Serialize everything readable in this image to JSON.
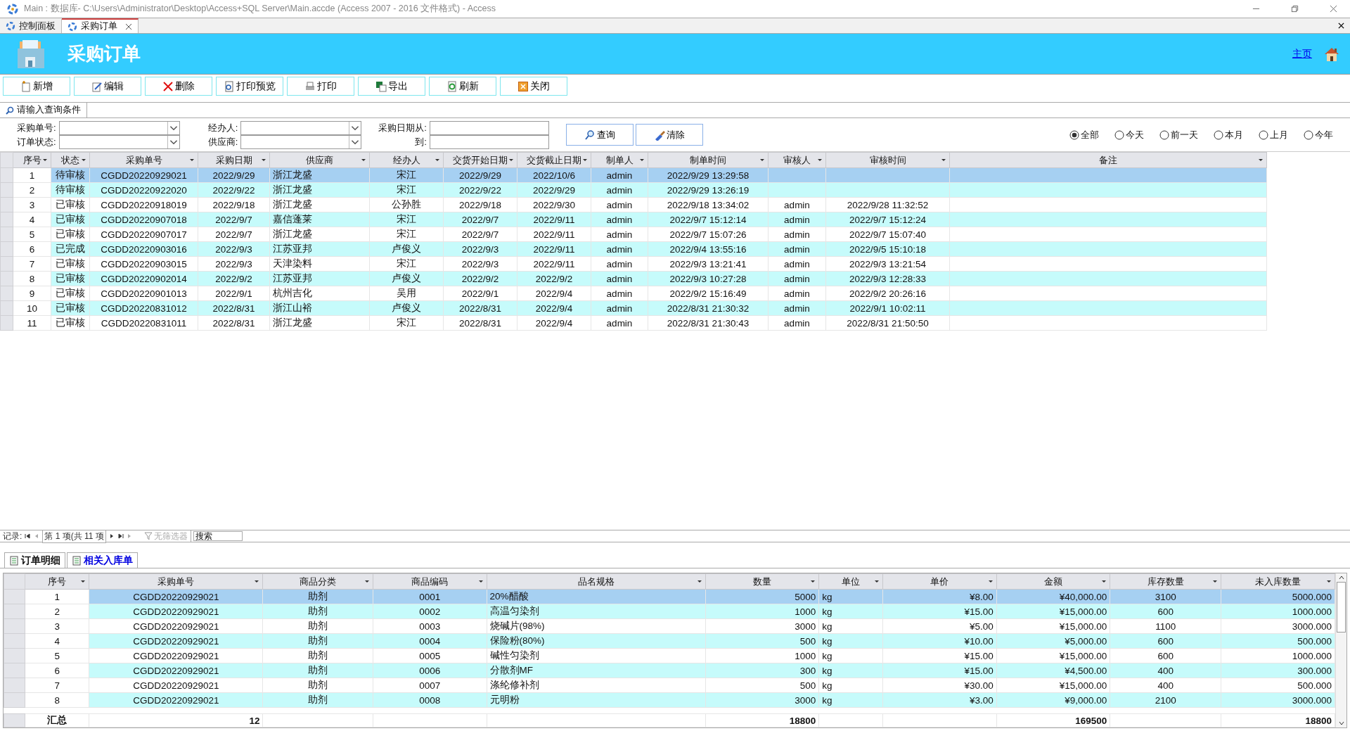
{
  "window": {
    "title": "Main : 数据库- C:\\Users\\Administrator\\Desktop\\Access+SQL Server\\Main.accde (Access 2007 - 2016 文件格式) - Access"
  },
  "doc_tabs": [
    {
      "label": "控制面板",
      "selected": false
    },
    {
      "label": "采购订单",
      "selected": true
    }
  ],
  "header": {
    "title": "采购订单",
    "home_link": "主页"
  },
  "toolbar": [
    {
      "kind": "new",
      "label": "新增"
    },
    {
      "kind": "edit",
      "label": "编辑"
    },
    {
      "kind": "delete",
      "label": "删除"
    },
    {
      "kind": "preview",
      "label": "打印预览"
    },
    {
      "kind": "print",
      "label": "打印"
    },
    {
      "kind": "export",
      "label": "导出"
    },
    {
      "kind": "refresh",
      "label": "刷新"
    },
    {
      "kind": "close",
      "label": "关闭"
    }
  ],
  "query": {
    "caption": "请输入查询条件",
    "fields": [
      {
        "label": "采购单号:",
        "kind": "combo"
      },
      {
        "label": "订单状态:",
        "kind": "combo"
      },
      {
        "label": "经办人:",
        "kind": "combo"
      },
      {
        "label": "供应商:",
        "kind": "combo"
      },
      {
        "label": "采购日期从:",
        "kind": "text"
      },
      {
        "label": "到:",
        "kind": "text"
      }
    ],
    "buttons": [
      {
        "kind": "search",
        "label": "查询"
      },
      {
        "kind": "clear",
        "label": "清除"
      }
    ],
    "ranges": [
      {
        "label": "全部",
        "selected": true
      },
      {
        "label": "今天",
        "selected": false
      },
      {
        "label": "前一天",
        "selected": false
      },
      {
        "label": "本月",
        "selected": false
      },
      {
        "label": "上月",
        "selected": false
      },
      {
        "label": "今年",
        "selected": false
      }
    ]
  },
  "orders": {
    "columns": [
      {
        "label": "序号",
        "kind": "center"
      },
      {
        "label": "状态",
        "kind": "center"
      },
      {
        "label": "采购单号",
        "kind": "center"
      },
      {
        "label": "采购日期",
        "kind": "center"
      },
      {
        "label": "供应商",
        "kind": "text"
      },
      {
        "label": "经办人",
        "kind": "center"
      },
      {
        "label": "交货开始日期",
        "kind": "center"
      },
      {
        "label": "交货截止日期",
        "kind": "center"
      },
      {
        "label": "制单人",
        "kind": "center"
      },
      {
        "label": "制单时间",
        "kind": "center"
      },
      {
        "label": "审核人",
        "kind": "center"
      },
      {
        "label": "审核时间",
        "kind": "center"
      },
      {
        "label": "备注",
        "kind": "text"
      }
    ],
    "rows": [
      {
        "selected": true,
        "cells": [
          "1",
          "待审核",
          "CGDD20220929021",
          "2022/9/29",
          "浙江龙盛",
          "宋江",
          "2022/9/29",
          "2022/10/6",
          "admin",
          "2022/9/29 13:29:58"
        ]
      },
      {
        "selected": false,
        "cells": [
          "2",
          "待审核",
          "CGDD20220922020",
          "2022/9/22",
          "浙江龙盛",
          "宋江",
          "2022/9/22",
          "2022/9/29",
          "admin",
          "2022/9/29 13:26:19"
        ]
      },
      {
        "selected": false,
        "cells": [
          "3",
          "已审核",
          "CGDD20220918019",
          "2022/9/18",
          "浙江龙盛",
          "公孙胜",
          "2022/9/18",
          "2022/9/30",
          "admin",
          "2022/9/18 13:34:02",
          "admin",
          "2022/9/28 11:32:52"
        ]
      },
      {
        "selected": false,
        "cells": [
          "4",
          "已审核",
          "CGDD20220907018",
          "2022/9/7",
          "嘉信蓬莱",
          "宋江",
          "2022/9/7",
          "2022/9/11",
          "admin",
          "2022/9/7 15:12:14",
          "admin",
          "2022/9/7 15:12:24"
        ]
      },
      {
        "selected": false,
        "cells": [
          "5",
          "已审核",
          "CGDD20220907017",
          "2022/9/7",
          "浙江龙盛",
          "宋江",
          "2022/9/7",
          "2022/9/11",
          "admin",
          "2022/9/7 15:07:26",
          "admin",
          "2022/9/7 15:07:40"
        ]
      },
      {
        "selected": false,
        "cells": [
          "6",
          "已完成",
          "CGDD20220903016",
          "2022/9/3",
          "江苏亚邦",
          "卢俊义",
          "2022/9/3",
          "2022/9/11",
          "admin",
          "2022/9/4 13:55:16",
          "admin",
          "2022/9/5 15:10:18"
        ]
      },
      {
        "selected": false,
        "cells": [
          "7",
          "已审核",
          "CGDD20220903015",
          "2022/9/3",
          "天津染料",
          "宋江",
          "2022/9/3",
          "2022/9/11",
          "admin",
          "2022/9/3 13:21:41",
          "admin",
          "2022/9/3 13:21:54"
        ]
      },
      {
        "selected": false,
        "cells": [
          "8",
          "已审核",
          "CGDD20220902014",
          "2022/9/2",
          "江苏亚邦",
          "卢俊义",
          "2022/9/2",
          "2022/9/2",
          "admin",
          "2022/9/3 10:27:28",
          "admin",
          "2022/9/3 12:28:33"
        ]
      },
      {
        "selected": false,
        "cells": [
          "9",
          "已审核",
          "CGDD20220901013",
          "2022/9/1",
          "杭州吉化",
          "吴用",
          "2022/9/1",
          "2022/9/4",
          "admin",
          "2022/9/2 15:16:49",
          "admin",
          "2022/9/2 20:26:16"
        ]
      },
      {
        "selected": false,
        "cells": [
          "10",
          "已审核",
          "CGDD20220831012",
          "2022/8/31",
          "浙江山裕",
          "卢俊义",
          "2022/8/31",
          "2022/9/4",
          "admin",
          "2022/8/31 21:30:32",
          "admin",
          "2022/9/1 10:02:11"
        ]
      },
      {
        "selected": false,
        "cells": [
          "11",
          "已审核",
          "CGDD20220831011",
          "2022/8/31",
          "浙江龙盛",
          "宋江",
          "2022/8/31",
          "2022/9/4",
          "admin",
          "2022/8/31 21:30:43",
          "admin",
          "2022/8/31 21:50:50"
        ]
      }
    ]
  },
  "navigator": {
    "label": "记录:",
    "position": "第 1 项(共 11 项",
    "filter": "无筛选器",
    "search_placeholder": "搜索"
  },
  "sub_tabs": [
    {
      "label": "订单明细",
      "selected": true
    },
    {
      "label": "相关入库单",
      "selected": false
    }
  ],
  "details": {
    "columns": [
      {
        "label": "序号",
        "kind": "center"
      },
      {
        "label": "采购单号",
        "kind": "center",
        "total": "12"
      },
      {
        "label": "商品分类",
        "kind": "center"
      },
      {
        "label": "商品编码",
        "kind": "center"
      },
      {
        "label": "品名规格",
        "kind": "text"
      },
      {
        "label": "数量",
        "kind": "num",
        "total": "18800"
      },
      {
        "label": "单位",
        "kind": "text"
      },
      {
        "label": "单价",
        "kind": "num"
      },
      {
        "label": "金额",
        "kind": "num",
        "total": "169500"
      },
      {
        "label": "库存数量",
        "kind": "center"
      },
      {
        "label": "未入库数量",
        "kind": "num",
        "total": "18800"
      }
    ],
    "rows": [
      {
        "selected": true,
        "cells": [
          "1",
          "CGDD20220929021",
          "助剂",
          "0001",
          "20%醋酸",
          "5000",
          "kg",
          "¥8.00",
          "¥40,000.00",
          "3100",
          "5000.000"
        ]
      },
      {
        "selected": false,
        "cells": [
          "2",
          "CGDD20220929021",
          "助剂",
          "0002",
          "高温匀染剂",
          "1000",
          "kg",
          "¥15.00",
          "¥15,000.00",
          "600",
          "1000.000"
        ]
      },
      {
        "selected": false,
        "cells": [
          "3",
          "CGDD20220929021",
          "助剂",
          "0003",
          "烧碱片(98%)",
          "3000",
          "kg",
          "¥5.00",
          "¥15,000.00",
          "1100",
          "3000.000"
        ]
      },
      {
        "selected": false,
        "cells": [
          "4",
          "CGDD20220929021",
          "助剂",
          "0004",
          "保险粉(80%)",
          "500",
          "kg",
          "¥10.00",
          "¥5,000.00",
          "600",
          "500.000"
        ]
      },
      {
        "selected": false,
        "cells": [
          "5",
          "CGDD20220929021",
          "助剂",
          "0005",
          "碱性匀染剂",
          "1000",
          "kg",
          "¥15.00",
          "¥15,000.00",
          "600",
          "1000.000"
        ]
      },
      {
        "selected": false,
        "cells": [
          "6",
          "CGDD20220929021",
          "助剂",
          "0006",
          "分散剂MF",
          "300",
          "kg",
          "¥15.00",
          "¥4,500.00",
          "400",
          "300.000"
        ]
      },
      {
        "selected": false,
        "cells": [
          "7",
          "CGDD20220929021",
          "助剂",
          "0007",
          "涤纶修补剂",
          "500",
          "kg",
          "¥30.00",
          "¥15,000.00",
          "400",
          "500.000"
        ]
      },
      {
        "selected": false,
        "cells": [
          "8",
          "CGDD20220929021",
          "助剂",
          "0008",
          "元明粉",
          "3000",
          "kg",
          "¥3.00",
          "¥9,000.00",
          "2100",
          "3000.000"
        ]
      }
    ],
    "total_label": "汇总"
  }
}
